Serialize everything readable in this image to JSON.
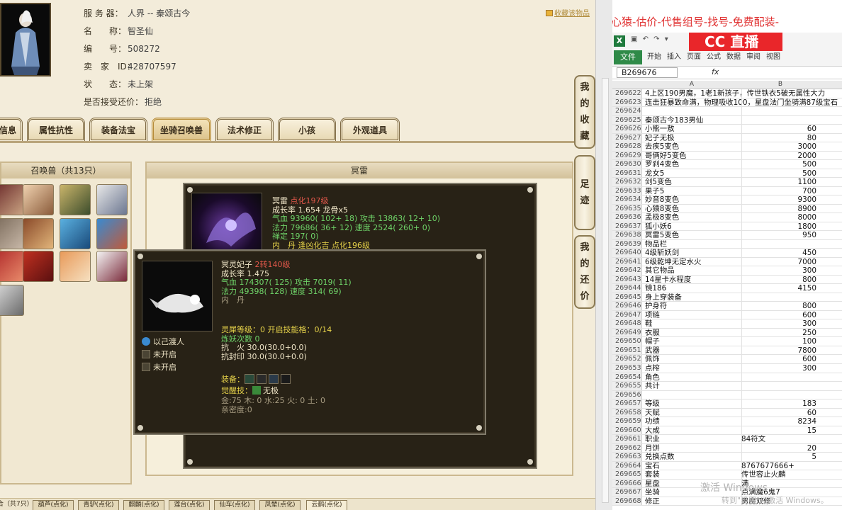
{
  "game": {
    "info": {
      "server_label": "服 务 器：",
      "server_value": "人界 -- 秦颂古今",
      "name_label": "名　　称：",
      "name_value": "智圣仙",
      "id_label": "编　　号：",
      "id_value": "508272",
      "seller_label": "卖　家　ID：",
      "seller_value": "428707597",
      "status_label": "状　　态：",
      "status_value": "未上架",
      "bargain_label": "是否接受还价：",
      "bargain_value": "拒绝",
      "favorite": "收藏该物品"
    },
    "tabs": [
      "信息",
      "属性抗性",
      "装备法宝",
      "坐骑召唤兽",
      "法术修正",
      "小孩",
      "外观道具"
    ],
    "active_tab": "坐骑召唤兽",
    "left_panel_title": "召唤兽（共13只）",
    "right_panel_title": "冥雷",
    "side_buttons": [
      {
        "label": [
          "我",
          "的",
          "收",
          "藏"
        ]
      },
      {
        "label": [
          "足",
          "迹"
        ]
      },
      {
        "label": [
          "我",
          "的",
          "还",
          "价"
        ]
      }
    ],
    "pet_card": {
      "name": "冥雷",
      "name_suffix": "点化197级",
      "growth": "成长率 1.654 龙骨x5",
      "hp": "气血 93960( 102+ 18) 攻击 13863( 12+ 10)",
      "mp": "法力 79686( 36+ 12) 速度 2524( 260+ 0)",
      "zen": "禅定 197( 0)",
      "hidden": "内　丹 逢凶化吉 点化196级"
    },
    "child_card": {
      "name": "冥灵妃子",
      "name_suffix": "2转140级",
      "growth": "成长率 1.475",
      "hp": "气血 174307( 125) 攻击 7019( 11)",
      "mp": "法力 49398( 128) 速度 314( 69)",
      "neidan": "内　丹",
      "spirit": "灵犀等级：0 开启技能格：0/14",
      "refine": "炼妖次数 0",
      "fire": "抗　火 30.0(30.0+0.0)",
      "seal": "抗封印 30.0(30.0+0.0)",
      "skills": [
        "以己渡人",
        "未开启",
        "未开启"
      ],
      "equip_label": "装备：",
      "awaken_label": "觉醒技：",
      "awaken_value": "无极",
      "elements": "金:75 木: 0 水:25 火: 0 土: 0",
      "intimacy": "亲密度:0"
    },
    "bottom_tabs": [
      "合（共7只）",
      "葫芦(点化)",
      "青驴(点化)",
      "麒麟(点化)",
      "莲台(点化)",
      "仙车(点化)",
      "凤辇(点化)",
      "云鹤(点化)"
    ]
  },
  "excel": {
    "banner": "心猿-估价-代售组号-找号-免费配装-",
    "logo_text": "CC 直播",
    "ribbon_tabs": [
      "文件",
      "开始",
      "插入",
      "页面",
      "公式",
      "数据",
      "审阅",
      "视图"
    ],
    "name_box": "B269676",
    "fx": "fx",
    "col_a": "A",
    "col_b": "B",
    "rows": [
      {
        "n": "269622",
        "a": "4上区190男魔，1老1新孩子，传世铁衣5破无属性大力",
        "b": "",
        "num": false
      },
      {
        "n": "269623",
        "a": "连击狂暴致命满，物理吸收100，星盘法门坐骑满87级宝石",
        "b": "",
        "num": false
      },
      {
        "n": "269624",
        "a": "",
        "b": "",
        "num": false
      },
      {
        "n": "269625",
        "a": "秦颂古今183男仙",
        "b": "",
        "num": false
      },
      {
        "n": "269626",
        "a": "小熊一敖",
        "b": "60",
        "num": true
      },
      {
        "n": "269627",
        "a": "妃子无极",
        "b": "80",
        "num": true
      },
      {
        "n": "269628",
        "a": "去疾5变色",
        "b": "3000",
        "num": true
      },
      {
        "n": "269629",
        "a": "哥俩好5变色",
        "b": "2000",
        "num": true
      },
      {
        "n": "269630",
        "a": "罗刹4变色",
        "b": "500",
        "num": true
      },
      {
        "n": "269631",
        "a": "龙女5",
        "b": "500",
        "num": true
      },
      {
        "n": "269632",
        "a": "剑5变色",
        "b": "1100",
        "num": true
      },
      {
        "n": "269633",
        "a": "果子5",
        "b": "700",
        "num": true
      },
      {
        "n": "269634",
        "a": "妙音8变色",
        "b": "9300",
        "num": true
      },
      {
        "n": "269635",
        "a": "心猿8变色",
        "b": "8900",
        "num": true
      },
      {
        "n": "269636",
        "a": "孟极8变色",
        "b": "8000",
        "num": true
      },
      {
        "n": "269637",
        "a": "狐小妖6",
        "b": "1800",
        "num": true
      },
      {
        "n": "269638",
        "a": "冥雷5变色",
        "b": "950",
        "num": true
      },
      {
        "n": "269639",
        "a": "物品栏",
        "b": "",
        "num": false
      },
      {
        "n": "269640",
        "a": "4级斩妖剑",
        "b": "450",
        "num": true
      },
      {
        "n": "269641",
        "a": "6级乾坤无定水火",
        "b": "7000",
        "num": true
      },
      {
        "n": "269642",
        "a": "其它物品",
        "b": "300",
        "num": true
      },
      {
        "n": "269643",
        "a": "14星卡水程度",
        "b": "800",
        "num": true
      },
      {
        "n": "269644",
        "a": "镜186",
        "b": "4150",
        "num": true
      },
      {
        "n": "269645",
        "a": "身上穿装备",
        "b": "",
        "num": false
      },
      {
        "n": "269646",
        "a": "护身符",
        "b": "800",
        "num": true
      },
      {
        "n": "269647",
        "a": "项链",
        "b": "600",
        "num": true
      },
      {
        "n": "269648",
        "a": "鞋",
        "b": "300",
        "num": true
      },
      {
        "n": "269649",
        "a": "衣服",
        "b": "250",
        "num": true
      },
      {
        "n": "269650",
        "a": "帽子",
        "b": "100",
        "num": true
      },
      {
        "n": "269651",
        "a": "武器",
        "b": "7800",
        "num": true
      },
      {
        "n": "269652",
        "a": "佩饰",
        "b": "600",
        "num": true
      },
      {
        "n": "269653",
        "a": "点榨",
        "b": "300",
        "num": true
      },
      {
        "n": "269654",
        "a": "角色",
        "b": "",
        "num": false
      },
      {
        "n": "269655",
        "a": "共计",
        "b": "",
        "num": false
      },
      {
        "n": "269656",
        "a": "",
        "b": "",
        "num": false
      },
      {
        "n": "269657",
        "a": "等级",
        "b": "183",
        "num": true
      },
      {
        "n": "269658",
        "a": "天赋",
        "b": "60",
        "num": true
      },
      {
        "n": "269659",
        "a": "功绩",
        "b": "8234",
        "num": true
      },
      {
        "n": "269660",
        "a": "大成",
        "b": "15",
        "num": true
      },
      {
        "n": "269661",
        "a": "职业",
        "b": "84符文",
        "num": false
      },
      {
        "n": "269662",
        "a": "月饼",
        "b": "20",
        "num": true
      },
      {
        "n": "269663",
        "a": "兑换点数",
        "b": "5",
        "num": true
      },
      {
        "n": "269664",
        "a": "宝石",
        "b": "8767677666+",
        "num": false
      },
      {
        "n": "269665",
        "a": "套装",
        "b": "传世容止火麟",
        "num": false
      },
      {
        "n": "269666",
        "a": "星盘",
        "b": "满",
        "num": false
      },
      {
        "n": "269667",
        "a": "坐骑",
        "b": "点满魔6鬼7",
        "num": false
      },
      {
        "n": "269668",
        "a": "修正",
        "b": "男魔双修",
        "num": false
      }
    ],
    "watermark_1": "激活 Windows",
    "watermark_2": "转到\"设置\"以激活 Windows。"
  },
  "colors": {
    "game_bg": "#f3ecda",
    "card_bg": "#282216",
    "stat_green": "#6fd469",
    "stat_yellow": "#e6d24a",
    "stat_red": "#e0574a",
    "banner_red": "#e03232",
    "excel_green": "#2f8a48"
  }
}
